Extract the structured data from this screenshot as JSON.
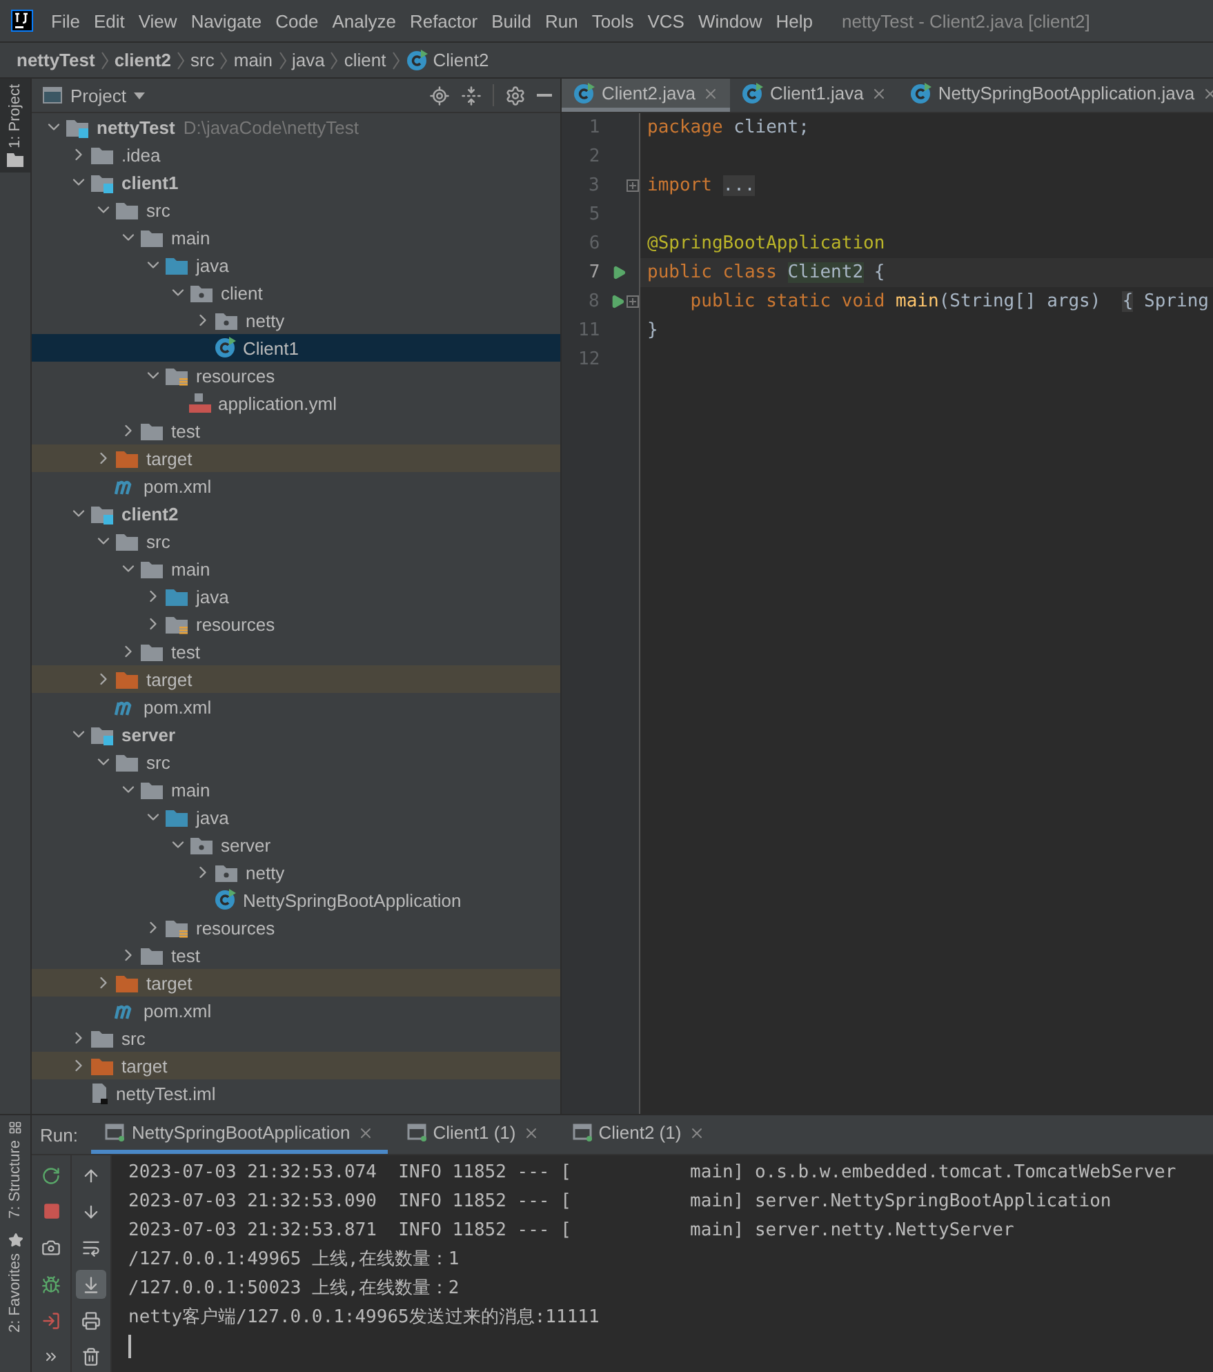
{
  "menu_bar": {
    "items": [
      "File",
      "Edit",
      "View",
      "Navigate",
      "Code",
      "Analyze",
      "Refactor",
      "Build",
      "Run",
      "Tools",
      "VCS",
      "Window",
      "Help"
    ],
    "title": "nettyTest - Client2.java [client2]"
  },
  "breadcrumb": [
    {
      "label": "nettyTest",
      "kind": "project"
    },
    {
      "label": "client2",
      "kind": "module"
    },
    {
      "label": "src",
      "kind": "folder"
    },
    {
      "label": "main",
      "kind": "folder"
    },
    {
      "label": "java",
      "kind": "folder"
    },
    {
      "label": "client",
      "kind": "folder"
    },
    {
      "label": "Client2",
      "kind": "class"
    }
  ],
  "left_stripe": [
    {
      "label": "1: Project",
      "selected": true
    }
  ],
  "project_panel": {
    "title": "Project",
    "tree": [
      {
        "label": "nettyTest",
        "hint": "D:\\javaCode\\nettyTest",
        "kind": "module",
        "expanded": true,
        "selected": false,
        "children": [
          {
            "label": ".idea",
            "kind": "folder",
            "expanded": false,
            "selected": false
          },
          {
            "label": "client1",
            "kind": "module",
            "expanded": true,
            "selected": false,
            "children": [
              {
                "label": "src",
                "kind": "folder",
                "expanded": true,
                "selected": false,
                "children": [
                  {
                    "label": "main",
                    "kind": "folder",
                    "expanded": true,
                    "selected": false,
                    "children": [
                      {
                        "label": "java",
                        "kind": "source",
                        "expanded": true,
                        "selected": false,
                        "children": [
                          {
                            "label": "client",
                            "kind": "package",
                            "expanded": true,
                            "selected": false,
                            "children": [
                              {
                                "label": "netty",
                                "kind": "package",
                                "expanded": false,
                                "selected": false
                              },
                              {
                                "label": "Client1",
                                "kind": "class",
                                "selected": true
                              }
                            ]
                          }
                        ]
                      },
                      {
                        "label": "resources",
                        "kind": "resources",
                        "expanded": true,
                        "selected": false,
                        "children": [
                          {
                            "label": "application.yml",
                            "kind": "yml",
                            "selected": false
                          }
                        ]
                      }
                    ]
                  },
                  {
                    "label": "test",
                    "kind": "folder",
                    "expanded": false,
                    "selected": false
                  }
                ]
              },
              {
                "label": "target",
                "kind": "excluded",
                "expanded": false,
                "selected": false
              },
              {
                "label": "pom.xml",
                "kind": "maven",
                "selected": false
              }
            ]
          },
          {
            "label": "client2",
            "kind": "module",
            "expanded": true,
            "selected": false,
            "children": [
              {
                "label": "src",
                "kind": "folder",
                "expanded": true,
                "selected": false,
                "children": [
                  {
                    "label": "main",
                    "kind": "folder",
                    "expanded": true,
                    "selected": false,
                    "children": [
                      {
                        "label": "java",
                        "kind": "source",
                        "expanded": false,
                        "selected": false
                      },
                      {
                        "label": "resources",
                        "kind": "resources",
                        "expanded": false,
                        "selected": false
                      }
                    ]
                  },
                  {
                    "label": "test",
                    "kind": "folder",
                    "expanded": false,
                    "selected": false
                  }
                ]
              },
              {
                "label": "target",
                "kind": "excluded",
                "expanded": false,
                "selected": false
              },
              {
                "label": "pom.xml",
                "kind": "maven",
                "selected": false
              }
            ]
          },
          {
            "label": "server",
            "kind": "module",
            "expanded": true,
            "selected": false,
            "children": [
              {
                "label": "src",
                "kind": "folder",
                "expanded": true,
                "selected": false,
                "children": [
                  {
                    "label": "main",
                    "kind": "folder",
                    "expanded": true,
                    "selected": false,
                    "children": [
                      {
                        "label": "java",
                        "kind": "source",
                        "expanded": true,
                        "selected": false,
                        "children": [
                          {
                            "label": "server",
                            "kind": "package",
                            "expanded": true,
                            "selected": false,
                            "children": [
                              {
                                "label": "netty",
                                "kind": "package",
                                "expanded": false,
                                "selected": false
                              },
                              {
                                "label": "NettySpringBootApplication",
                                "kind": "class",
                                "selected": false
                              }
                            ]
                          }
                        ]
                      },
                      {
                        "label": "resources",
                        "kind": "resources",
                        "expanded": false,
                        "selected": false
                      }
                    ]
                  },
                  {
                    "label": "test",
                    "kind": "folder",
                    "expanded": false,
                    "selected": false
                  }
                ]
              },
              {
                "label": "target",
                "kind": "excluded",
                "expanded": false,
                "selected": false
              },
              {
                "label": "pom.xml",
                "kind": "maven",
                "selected": false
              }
            ]
          },
          {
            "label": "src",
            "kind": "folder",
            "expanded": false,
            "selected": false
          },
          {
            "label": "target",
            "kind": "excluded",
            "expanded": false,
            "selected": false
          },
          {
            "label": "nettyTest.iml",
            "kind": "iml",
            "selected": false
          }
        ]
      }
    ]
  },
  "editor": {
    "tabs": [
      {
        "label": "Client2.java",
        "selected": true
      },
      {
        "label": "Client1.java",
        "selected": false
      },
      {
        "label": "NettySpringBootApplication.java",
        "selected": false
      }
    ],
    "lines": [
      {
        "number": "1",
        "run": false,
        "fold": false,
        "current": false,
        "tokens": [
          {
            "kind": "keyword",
            "text": "package"
          },
          {
            "kind": "plain",
            "text": " client;"
          }
        ]
      },
      {
        "number": "2",
        "run": false,
        "fold": false,
        "current": false
      },
      {
        "number": "3",
        "run": false,
        "fold": true,
        "current": false,
        "tokens": [
          {
            "kind": "keyword",
            "text": "import"
          },
          {
            "kind": "folded",
            "text": "..."
          }
        ]
      },
      {
        "number": "5",
        "run": false,
        "fold": false,
        "current": false
      },
      {
        "number": "6",
        "run": false,
        "fold": false,
        "current": false,
        "tokens": [
          {
            "kind": "annotation",
            "text": "@SpringBootApplication"
          }
        ]
      },
      {
        "number": "7",
        "run": true,
        "fold": false,
        "current": true,
        "tokens": [
          {
            "kind": "keyword",
            "text": "public class"
          },
          {
            "kind": "highlight",
            "text": "Client2"
          },
          {
            "kind": "plain",
            "text": " {"
          }
        ]
      },
      {
        "number": "8",
        "run": true,
        "fold": true,
        "current": false,
        "indent": true,
        "tokens": [
          {
            "kind": "keyword",
            "text": "public static void"
          },
          {
            "kind": "method",
            "text": "main"
          },
          {
            "kind": "plain",
            "text": "(String[] args) "
          },
          {
            "kind": "folded",
            "text": "{"
          },
          {
            "kind": "plain",
            "text": " Spring"
          }
        ]
      },
      {
        "number": "11",
        "run": false,
        "fold": false,
        "current": false,
        "tokens": [
          {
            "kind": "plain",
            "text": "}"
          }
        ]
      },
      {
        "number": "12",
        "run": false,
        "fold": false,
        "current": false
      }
    ]
  },
  "run_panel": {
    "label": "Run:",
    "tabs": [
      {
        "label": "NettySpringBootApplication",
        "selected": true
      },
      {
        "label": "Client1 (1)",
        "selected": false
      },
      {
        "label": "Client2 (1)",
        "selected": false
      }
    ],
    "soft_wrap": false,
    "scroll_to_end": true,
    "console": [
      "2023-07-03 21:32:53.074  INFO 11852 --- [           main] o.s.b.w.embedded.tomcat.TomcatWebServer",
      "2023-07-03 21:32:53.090  INFO 11852 --- [           main] server.NettySpringBootApplication",
      "2023-07-03 21:32:53.871  INFO 11852 --- [           main] server.netty.NettyServer",
      "/127.0.0.1:49965 上线,在线数量：1",
      "/127.0.0.1:50023 上线,在线数量：2",
      "netty客户端/127.0.0.1:49965发送过来的消息:11111"
    ]
  },
  "bottom_stripe": [
    {
      "label": "7: Structure",
      "kind": "structure"
    },
    {
      "label": "2: Favorites",
      "kind": "favorites"
    }
  ]
}
